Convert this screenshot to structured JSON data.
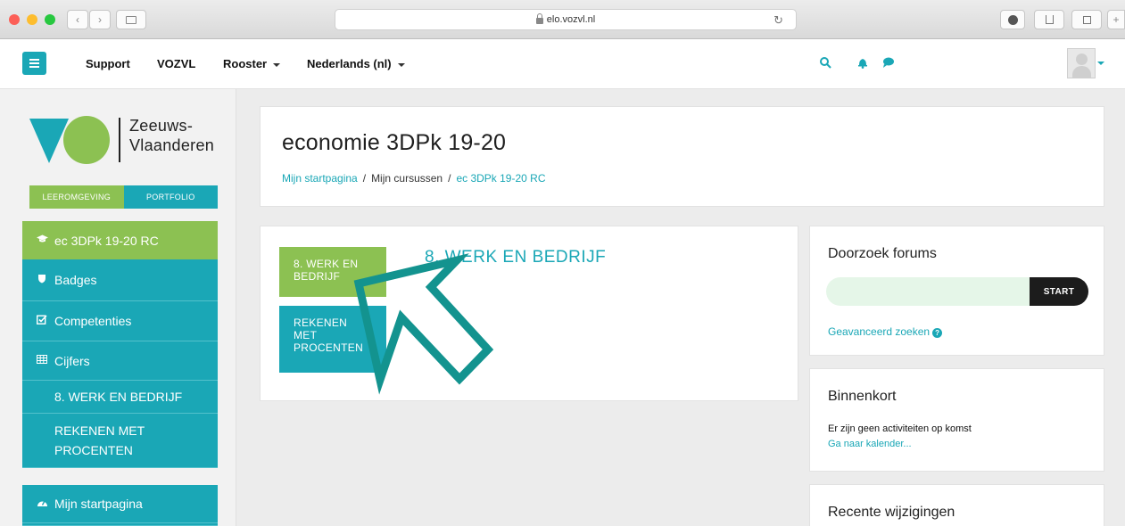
{
  "browser": {
    "url": "elo.vozvl.nl",
    "reload_icon": "↻"
  },
  "navbar": {
    "links": [
      "Support",
      "VOZVL",
      "Rooster",
      "Nederlands (nl)"
    ],
    "icons": [
      "search-icon",
      "bell-icon",
      "chat-icon"
    ]
  },
  "sidebar": {
    "logo_text_line1": "Zeeuws-",
    "logo_text_line2": "Vlaanderen",
    "tabs": [
      "LEEROMGEVING",
      "PORTFOLIO"
    ],
    "items": [
      {
        "label": "ec 3DPk 19-20 RC",
        "icon": "graduation-cap-icon"
      },
      {
        "label": "Badges",
        "icon": "shield-icon"
      },
      {
        "label": "Competenties",
        "icon": "checkbox-icon"
      },
      {
        "label": "Cijfers",
        "icon": "table-icon"
      },
      {
        "label": "8. WERK EN BEDRIJF"
      },
      {
        "label_line1": "REKENEN MET",
        "label_line2": "PROCENTEN"
      },
      {
        "label": "Mijn startpagina",
        "icon": "dashboard-icon"
      }
    ]
  },
  "main": {
    "title": "economie 3DPk 19-20",
    "breadcrumb": [
      "Mijn startpagina",
      "Mijn cursussen",
      "ec 3DPk 19-20 RC"
    ],
    "breadcrumb_sep": "/",
    "tiles": [
      {
        "line1": "8. WERK EN",
        "line2": "BEDRIJF",
        "line3": ""
      },
      {
        "line1": "REKENEN",
        "line2": "MET",
        "line3": "PROCENTEN"
      }
    ],
    "section_heading": "8. WERK EN BEDRIJF"
  },
  "blocks": {
    "forum_search": {
      "title": "Doorzoek forums",
      "button": "START",
      "advanced_link": "Geavanceerd zoeken",
      "help": "?"
    },
    "upcoming": {
      "title": "Binnenkort",
      "text": "Er zijn geen activiteiten op komst",
      "link": "Ga naar kalender..."
    },
    "recent": {
      "title": "Recente wijzigingen"
    }
  },
  "colors": {
    "teal": "#1aa7b6",
    "green": "#8cc152",
    "arrow": "#13938f"
  }
}
